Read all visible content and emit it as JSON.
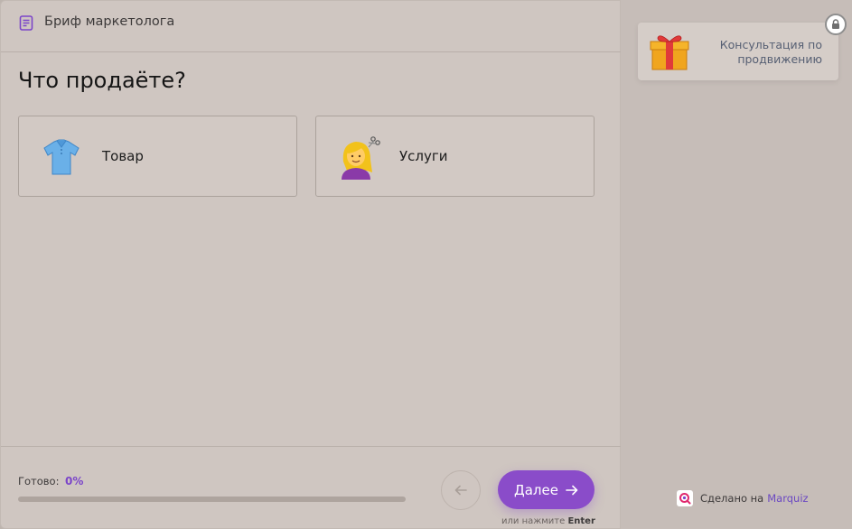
{
  "header": {
    "title": "Бриф маркетолога",
    "icon": "form-icon"
  },
  "question": {
    "text": "Что продаёте?",
    "options": [
      {
        "label": "Товар",
        "icon": "shirt-icon"
      },
      {
        "label": "Услуги",
        "icon": "hairdresser-icon"
      }
    ]
  },
  "footer": {
    "progress_label": "Готово:",
    "progress_value": "0%",
    "progress_fraction": 0,
    "back_icon": "arrow-left-icon",
    "next_label": "Далее",
    "next_icon": "arrow-right-icon",
    "enter_hint_prefix": "или нажмите",
    "enter_hint_key": "Enter"
  },
  "sidebar": {
    "promo_text": "Консультация по продвижению",
    "promo_icon": "gift-icon",
    "lock_icon": "lock-icon",
    "made_by_prefix": "Сделано на",
    "made_by_brand": "Marquiz",
    "made_by_icon": "marquiz-logo-icon"
  },
  "colors": {
    "accent": "#8a4cc9",
    "progress_text": "#7b45c9",
    "background_main": "#cfc6c1",
    "background_sidebar": "#c6bdb8"
  }
}
